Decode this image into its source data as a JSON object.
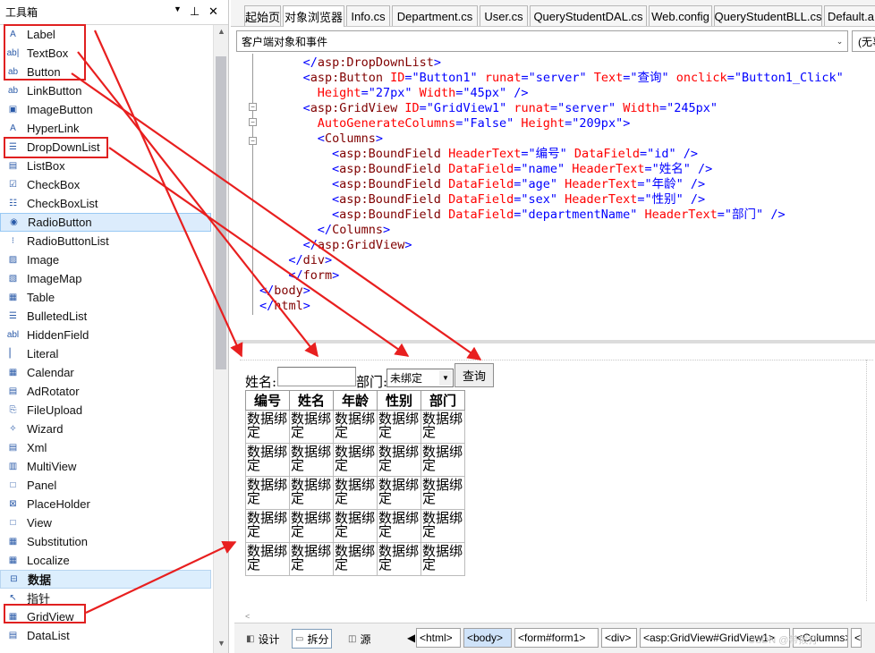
{
  "toolbox": {
    "title": "工具箱",
    "pin_glyph": "▼ ",
    "close_glyph": "✕",
    "items": [
      {
        "label": "Label",
        "icon": "label-icon"
      },
      {
        "label": "TextBox",
        "icon": "textbox-icon"
      },
      {
        "label": "Button",
        "icon": "button-icon"
      },
      {
        "label": "LinkButton",
        "icon": "linkbutton-icon"
      },
      {
        "label": "ImageButton",
        "icon": "imagebutton-icon"
      },
      {
        "label": "HyperLink",
        "icon": "hyperlink-icon"
      },
      {
        "label": "DropDownList",
        "icon": "dropdownlist-icon"
      },
      {
        "label": "ListBox",
        "icon": "listbox-icon"
      },
      {
        "label": "CheckBox",
        "icon": "checkbox-icon"
      },
      {
        "label": "CheckBoxList",
        "icon": "checkboxlist-icon"
      },
      {
        "label": "RadioButton",
        "icon": "radiobutton-icon"
      },
      {
        "label": "RadioButtonList",
        "icon": "radiobuttonlist-icon"
      },
      {
        "label": "Image",
        "icon": "image-icon"
      },
      {
        "label": "ImageMap",
        "icon": "imagemap-icon"
      },
      {
        "label": "Table",
        "icon": "table-icon"
      },
      {
        "label": "BulletedList",
        "icon": "bulletedlist-icon"
      },
      {
        "label": "HiddenField",
        "icon": "hiddenfield-icon"
      },
      {
        "label": "Literal",
        "icon": "literal-icon"
      },
      {
        "label": "Calendar",
        "icon": "calendar-icon"
      },
      {
        "label": "AdRotator",
        "icon": "adrotator-icon"
      },
      {
        "label": "FileUpload",
        "icon": "fileupload-icon"
      },
      {
        "label": "Wizard",
        "icon": "wizard-icon"
      },
      {
        "label": "Xml",
        "icon": "xml-icon"
      },
      {
        "label": "MultiView",
        "icon": "multiview-icon"
      },
      {
        "label": "Panel",
        "icon": "panel-icon"
      },
      {
        "label": "PlaceHolder",
        "icon": "placeholder-icon"
      },
      {
        "label": "View",
        "icon": "view-icon"
      },
      {
        "label": "Substitution",
        "icon": "substitution-icon"
      },
      {
        "label": "Localize",
        "icon": "localize-icon"
      }
    ],
    "selected_item": "RadioButton",
    "data_group": {
      "label": "数据",
      "expander": "⊟"
    },
    "data_items": [
      {
        "label": "指针",
        "icon": "pointer-icon"
      },
      {
        "label": "GridView",
        "icon": "gridview-icon"
      },
      {
        "label": "DataList",
        "icon": "datalist-icon"
      }
    ]
  },
  "tabs": [
    {
      "label": "起始页"
    },
    {
      "label": "对象浏览器",
      "active": true
    },
    {
      "label": "Info.cs"
    },
    {
      "label": "Department.cs"
    },
    {
      "label": "User.cs"
    },
    {
      "label": "QueryStudentDAL.cs"
    },
    {
      "label": "Web.config"
    },
    {
      "label": "QueryStudentBLL.cs"
    },
    {
      "label": "Default.a"
    }
  ],
  "editor_bar": {
    "object_select": "客户端对象和事件",
    "event_select": "(无事"
  },
  "code_lines": [
    {
      "indent": 7,
      "parts": [
        [
          "br",
          "</"
        ],
        [
          "tg",
          "asp:DropDownList"
        ],
        [
          "br",
          ">"
        ]
      ]
    },
    {
      "indent": 7,
      "parts": [
        [
          "br",
          "<"
        ],
        [
          "tg",
          "asp:Button"
        ],
        [
          "at",
          " ID"
        ],
        [
          "br",
          "=\"Button1\""
        ],
        [
          "at",
          " runat"
        ],
        [
          "br",
          "=\"server\""
        ],
        [
          "at",
          " Text"
        ],
        [
          "br",
          "=\"查询\""
        ],
        [
          "at",
          " onclick"
        ],
        [
          "br",
          "=\"Button1_Click\""
        ]
      ]
    },
    {
      "indent": 9,
      "parts": [
        [
          "at",
          "Height"
        ],
        [
          "br",
          "=\"27px\""
        ],
        [
          "at",
          " Width"
        ],
        [
          "br",
          "=\"45px\""
        ],
        [
          "br",
          " />"
        ]
      ]
    },
    {
      "indent": 7,
      "parts": [
        [
          "br",
          "<"
        ],
        [
          "tg",
          "asp:GridView"
        ],
        [
          "at",
          " ID"
        ],
        [
          "br",
          "=\"GridView1\""
        ],
        [
          "at",
          " runat"
        ],
        [
          "br",
          "=\"server\""
        ],
        [
          "at",
          " Width"
        ],
        [
          "br",
          "=\"245px\""
        ]
      ]
    },
    {
      "indent": 9,
      "parts": [
        [
          "at",
          "AutoGenerateColumns"
        ],
        [
          "br",
          "=\"False\""
        ],
        [
          "at",
          " Height"
        ],
        [
          "br",
          "=\"209px\""
        ],
        [
          "br",
          ">"
        ]
      ]
    },
    {
      "indent": 9,
      "parts": [
        [
          "br",
          "<"
        ],
        [
          "tg",
          "Columns"
        ],
        [
          "br",
          ">"
        ]
      ]
    },
    {
      "indent": 11,
      "parts": [
        [
          "br",
          "<"
        ],
        [
          "tg",
          "asp:BoundField"
        ],
        [
          "at",
          " HeaderText"
        ],
        [
          "br",
          "=\"编号\""
        ],
        [
          "at",
          " DataField"
        ],
        [
          "br",
          "=\"id\""
        ],
        [
          "br",
          " />"
        ]
      ]
    },
    {
      "indent": 11,
      "parts": [
        [
          "br",
          "<"
        ],
        [
          "tg",
          "asp:BoundField"
        ],
        [
          "at",
          " DataField"
        ],
        [
          "br",
          "=\"name\""
        ],
        [
          "at",
          " HeaderText"
        ],
        [
          "br",
          "=\"姓名\""
        ],
        [
          "br",
          " />"
        ]
      ]
    },
    {
      "indent": 11,
      "parts": [
        [
          "br",
          "<"
        ],
        [
          "tg",
          "asp:BoundField"
        ],
        [
          "at",
          " DataField"
        ],
        [
          "br",
          "=\"age\""
        ],
        [
          "at",
          " HeaderText"
        ],
        [
          "br",
          "=\"年龄\""
        ],
        [
          "br",
          " />"
        ]
      ]
    },
    {
      "indent": 11,
      "parts": [
        [
          "br",
          "<"
        ],
        [
          "tg",
          "asp:BoundField"
        ],
        [
          "at",
          " DataField"
        ],
        [
          "br",
          "=\"sex\""
        ],
        [
          "at",
          " HeaderText"
        ],
        [
          "br",
          "=\"性别\""
        ],
        [
          "br",
          " />"
        ]
      ]
    },
    {
      "indent": 11,
      "parts": [
        [
          "br",
          "<"
        ],
        [
          "tg",
          "asp:BoundField"
        ],
        [
          "at",
          " DataField"
        ],
        [
          "br",
          "=\"departmentName\""
        ],
        [
          "at",
          " HeaderText"
        ],
        [
          "br",
          "=\"部门\""
        ],
        [
          "br",
          " />"
        ]
      ]
    },
    {
      "indent": 9,
      "parts": [
        [
          "br",
          "</"
        ],
        [
          "tg",
          "Columns"
        ],
        [
          "br",
          ">"
        ]
      ]
    },
    {
      "indent": 7,
      "parts": [
        [
          "br",
          "</"
        ],
        [
          "tg",
          "asp:GridView"
        ],
        [
          "br",
          ">"
        ]
      ]
    },
    {
      "indent": 5,
      "parts": [
        [
          "br",
          "</"
        ],
        [
          "tg",
          "div"
        ],
        [
          "br",
          ">"
        ]
      ]
    },
    {
      "indent": 5,
      "parts": [
        [
          "br",
          "</"
        ],
        [
          "tg",
          "form"
        ],
        [
          "br",
          ">"
        ]
      ]
    },
    {
      "indent": 1,
      "parts": [
        [
          "br",
          "</"
        ],
        [
          "tg",
          "body"
        ],
        [
          "br",
          ">"
        ]
      ]
    },
    {
      "indent": 1,
      "parts": [
        [
          "br",
          "</"
        ],
        [
          "tg",
          "html"
        ],
        [
          "br",
          ">"
        ]
      ]
    }
  ],
  "design": {
    "name_label": "姓名:",
    "dept_label": "部门:",
    "dept_select_value": "未绑定",
    "query_button": "查询",
    "grid_headers": [
      "编号",
      "姓名",
      "年龄",
      "性别",
      "部门"
    ],
    "grid_cell_text": "数据绑定",
    "grid_row_count": 5
  },
  "bottom": {
    "design_tab": "设计",
    "split_tab": "拆分",
    "source_tab": "源",
    "breadcrumbs": [
      "<html>",
      "<body>",
      "<form#form1>",
      "<div>",
      "<asp:GridView#GridView1>",
      "<Columns>",
      "<"
    ],
    "active_crumb": "<body>"
  },
  "watermark": "CSDN @带拨打"
}
